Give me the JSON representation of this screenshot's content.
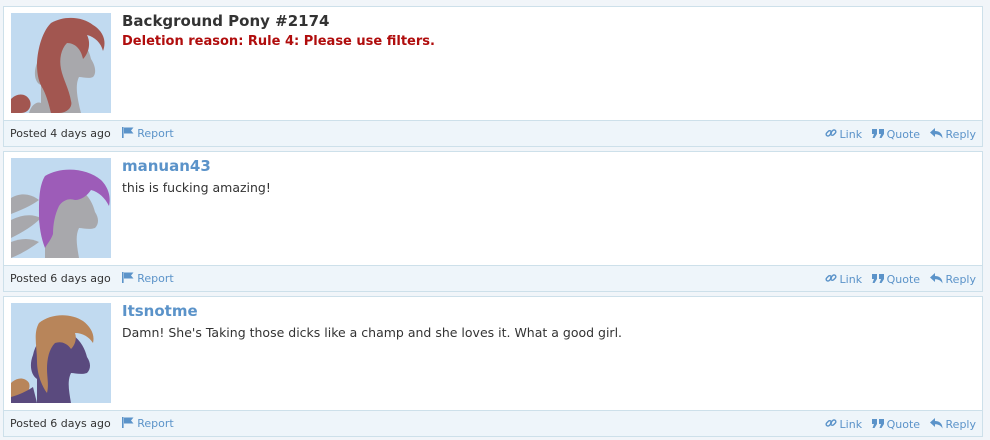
{
  "comments": [
    {
      "author": "Background Pony #2174",
      "author_is_link": false,
      "message": "Deletion reason: Rule 4: Please use filters.",
      "message_is_deletion": true,
      "posted_label": "Posted",
      "posted_time": "4 days ago",
      "report_label": "Report",
      "link_label": "Link",
      "quote_label": "Quote",
      "reply_label": "Reply",
      "avatar": {
        "body_color": "#a8a8ac",
        "mane_color": "#a25650"
      }
    },
    {
      "author": "manuan43",
      "author_is_link": true,
      "message": "this is fucking amazing!",
      "message_is_deletion": false,
      "posted_label": "Posted",
      "posted_time": "6 days ago",
      "report_label": "Report",
      "link_label": "Link",
      "quote_label": "Quote",
      "reply_label": "Reply",
      "avatar": {
        "body_color": "#a8a8ac",
        "mane_color": "#9d5cb8"
      }
    },
    {
      "author": "Itsnotme",
      "author_is_link": true,
      "message": "Damn! She's Taking those dicks like a champ and she loves it. What a good girl.",
      "message_is_deletion": false,
      "posted_label": "Posted",
      "posted_time": "6 days ago",
      "report_label": "Report",
      "link_label": "Link",
      "quote_label": "Quote",
      "reply_label": "Reply",
      "avatar": {
        "body_color": "#5a4a7e",
        "mane_color": "#b8855a"
      }
    }
  ],
  "colors": {
    "link": "#5b93c9",
    "deletion": "#b00d0d",
    "avatar_bg": "#c1daf0",
    "footer_bg": "#eef5fa",
    "border": "#cde0ea"
  },
  "icons": {
    "report": "flag-icon",
    "link": "chain-link-icon",
    "quote": "quote-icon",
    "reply": "reply-arrow-icon"
  }
}
